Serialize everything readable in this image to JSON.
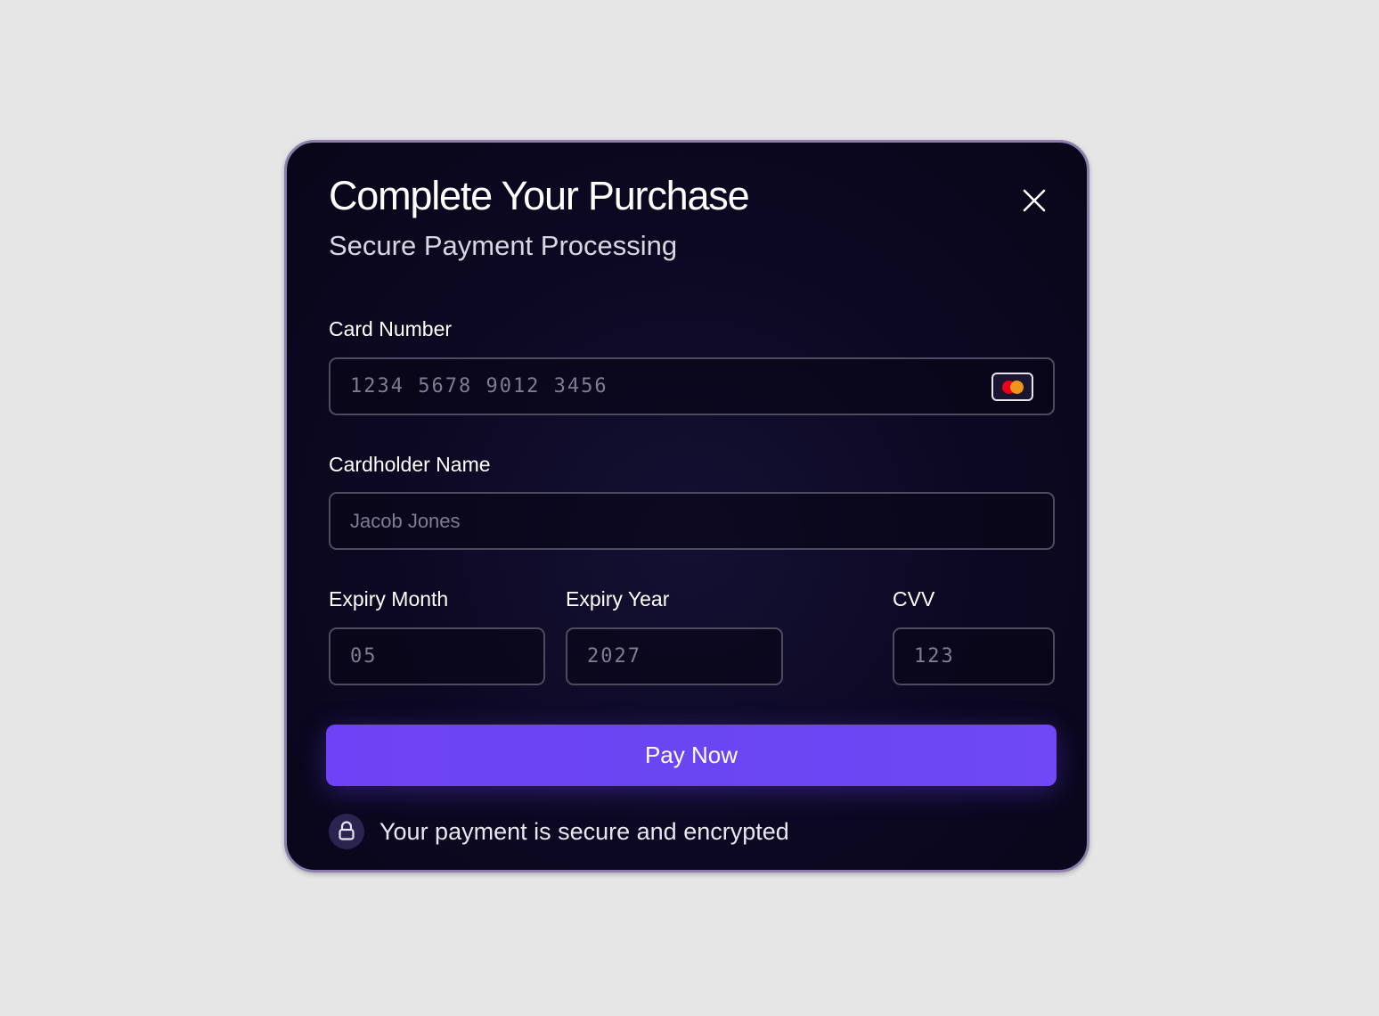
{
  "modal": {
    "title": "Complete Your Purchase",
    "subtitle": "Secure Payment Processing",
    "close_icon": "close-icon"
  },
  "form": {
    "card_number": {
      "label": "Card Number",
      "placeholder": "1234 5678 9012 3456",
      "value": "",
      "card_icon": "mastercard-icon"
    },
    "cardholder_name": {
      "label": "Cardholder Name",
      "placeholder": "Jacob Jones",
      "value": ""
    },
    "expiry_month": {
      "label": "Expiry Month",
      "placeholder": "05",
      "value": ""
    },
    "expiry_year": {
      "label": "Expiry Year",
      "placeholder": "2027",
      "value": ""
    },
    "cvv": {
      "label": "CVV",
      "placeholder": "123",
      "value": ""
    }
  },
  "actions": {
    "pay_label": "Pay Now"
  },
  "footer": {
    "secure_text": "Your payment is secure and encrypted",
    "icon": "lock-icon"
  },
  "colors": {
    "page_background": "#e6e6e6",
    "modal_background": "#0c0822",
    "modal_border": "#8a7fae",
    "accent": "#6a45f2",
    "text_primary": "#ffffff",
    "placeholder": "#7f7b94"
  }
}
